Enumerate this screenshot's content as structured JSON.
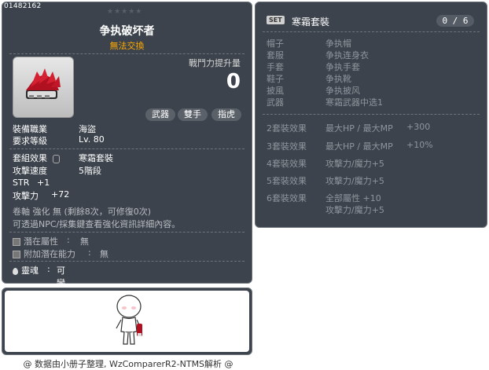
{
  "item": {
    "id": "01482162",
    "stars": "★★★★★",
    "name": "争执破坏者",
    "trade": "無法交換",
    "power_label": "戰鬥力提升量",
    "power_value": "0",
    "tags": [
      "武器",
      "雙手",
      "指虎"
    ],
    "job_label": "裝備職業",
    "job_value": "海盜",
    "req_level_label": "要求等級",
    "req_level_value": "Lv. 80",
    "set_label": "套組效果",
    "set_value": "寒霜套裝",
    "speed_label": "攻擊速度",
    "speed_value": "5階段",
    "str_label": "STR",
    "str_value": "+1",
    "atk_label": "攻擊力",
    "atk_value": "+72",
    "upgrade_text": "卷軸 強化 無 (剩餘8次，可修復0次)",
    "npc_text": "可透過NPC/採集鍵查看強化資訊詳細內容。",
    "potential_label": "潛在屬性",
    "potential_value": "無",
    "add_potential_label": "附加潛在能力",
    "add_potential_value": "無",
    "soul_label": "靈魂",
    "soul_value": "可變換為靈魂武器"
  },
  "set": {
    "badge": "SET",
    "title": "寒霜套裝",
    "count": "0 / 6",
    "parts": [
      {
        "slot": "帽子",
        "name": "争执帽"
      },
      {
        "slot": "套服",
        "name": "争执连身衣"
      },
      {
        "slot": "手套",
        "name": "争执手套"
      },
      {
        "slot": "鞋子",
        "name": "争执靴"
      },
      {
        "slot": "披風",
        "name": "争执披风"
      },
      {
        "slot": "武器",
        "name": "寒霜武器中选1"
      }
    ],
    "effects": [
      {
        "label": "2套裝效果",
        "stat": "最大HP / 最大MP",
        "value": "+300"
      },
      {
        "label": "3套裝效果",
        "stat": "最大HP / 最大MP",
        "value": "+10%"
      },
      {
        "label": "4套裝效果",
        "stat": "攻擊力/魔力+5",
        "value": ""
      },
      {
        "label": "5套裝效果",
        "stat": "攻擊力/魔力+5",
        "value": ""
      },
      {
        "label": "6套裝效果",
        "stat": "全部屬性 +10",
        "value": ""
      },
      {
        "label": "",
        "stat": "攻擊力/魔力+5",
        "value": ""
      }
    ]
  },
  "credit": "@ 数据由小册子整理, WzComparerR2-NTMS解析 @",
  "colors": {
    "panel": "#3c434c",
    "trade": "#ffaa00",
    "muted": "#8f959c"
  }
}
